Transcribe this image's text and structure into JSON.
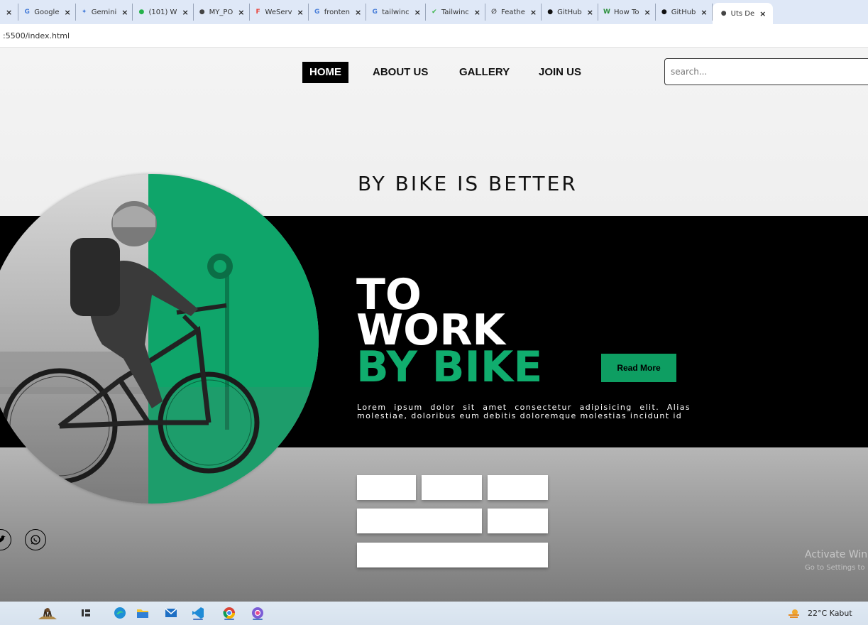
{
  "browser": {
    "tabs": [
      {
        "label": "Google",
        "icon_color": "#4a7fd9",
        "icon_char": "G"
      },
      {
        "label": "Gemini",
        "icon_color": "#4a7fd9",
        "icon_char": "✦"
      },
      {
        "label": "(101) W",
        "icon_color": "#25b24b",
        "icon_char": "●"
      },
      {
        "label": "MY_PO",
        "icon_color": "#444444",
        "icon_char": "●"
      },
      {
        "label": "WeServ",
        "icon_color": "#e8453c",
        "icon_char": "F"
      },
      {
        "label": "fronten",
        "icon_color": "#4a7fd9",
        "icon_char": "G"
      },
      {
        "label": "tailwinc",
        "icon_color": "#4a7fd9",
        "icon_char": "G"
      },
      {
        "label": "Tailwinc",
        "icon_color": "#3bb54a",
        "icon_char": "✔"
      },
      {
        "label": "Feathe",
        "icon_color": "#444444",
        "icon_char": "∅"
      },
      {
        "label": "GitHub",
        "icon_color": "#111111",
        "icon_char": "●"
      },
      {
        "label": "How To",
        "icon_color": "#2a8f3a",
        "icon_char": "W"
      },
      {
        "label": "GitHub",
        "icon_color": "#111111",
        "icon_char": "●"
      },
      {
        "label": "Uts De",
        "icon_color": "#444444",
        "icon_char": "●"
      }
    ],
    "address": ":5500/index.html"
  },
  "nav": {
    "items": [
      "HOME",
      "ABOUT US",
      "GALLERY",
      "JOIN US"
    ],
    "search_placeholder": "search..."
  },
  "hero": {
    "tagline": "BY BIKE IS BETTER",
    "headline_line1": "TO",
    "headline_line2": "WORK",
    "headline_line3": "BY BIKE",
    "read_more": "Read More",
    "lorem": "Lorem ipsum dolor sit amet consectetur adipisicing elit. Alias molestiae, doloribus eum debitis doloremque molestias incidunt id",
    "accent_color": "#0e9e62"
  },
  "watermark": {
    "line1": "Activate Win",
    "line2": "Go to Settings to"
  },
  "taskbar": {
    "weather": "22°C  Kabut"
  }
}
